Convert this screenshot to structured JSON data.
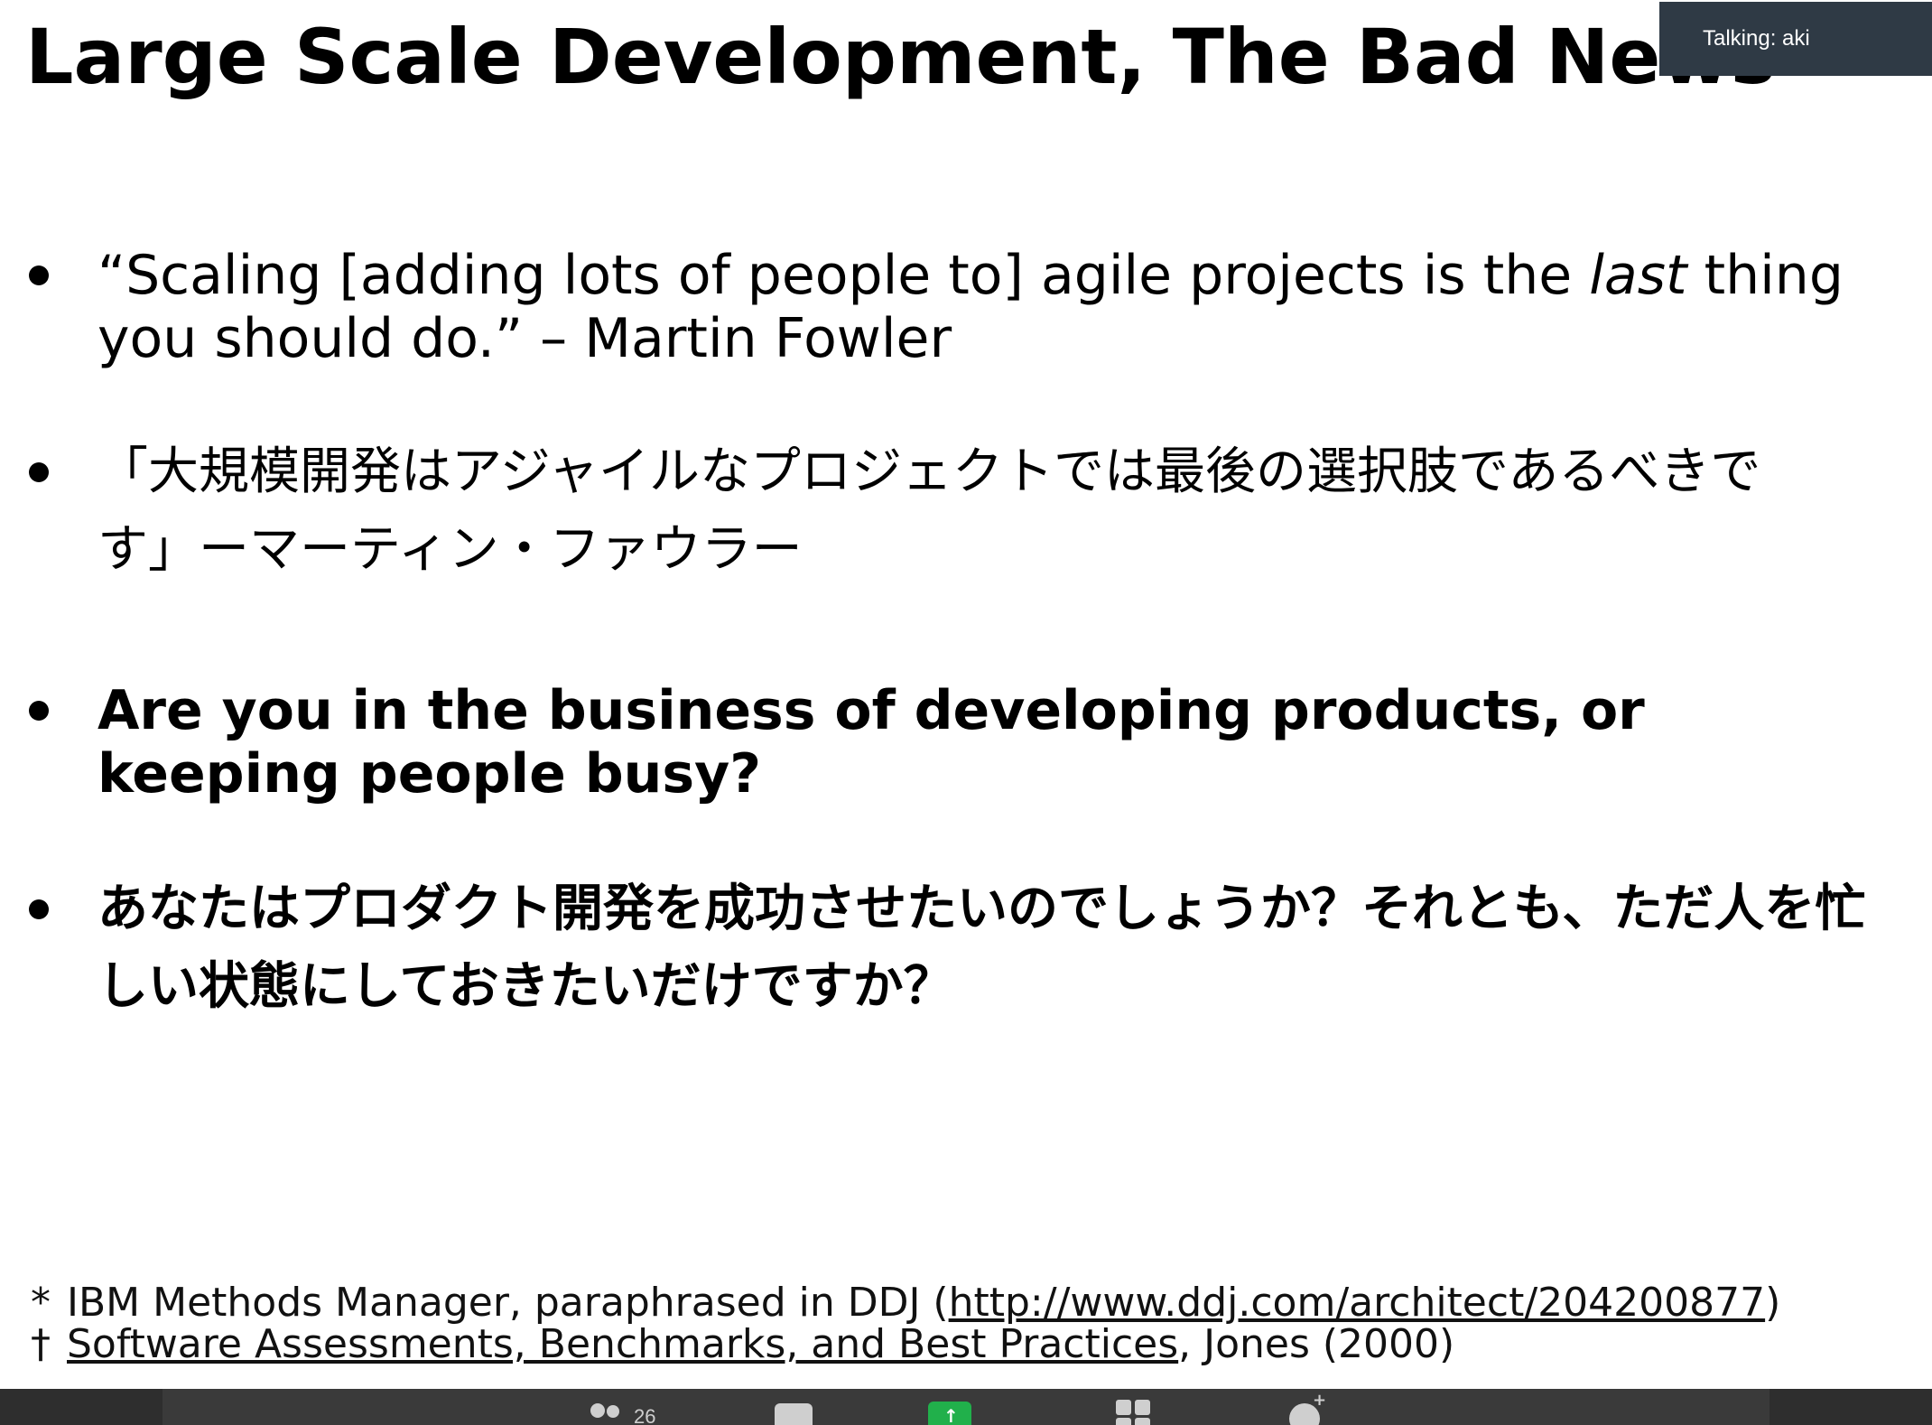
{
  "slide": {
    "title": "Large Scale Development, The Bad News",
    "bullets": [
      {
        "text_before": "“Scaling [adding lots of people to] agile projects is the ",
        "emphasis": "last",
        "text_after": " thing you should do.” – Martin Fowler"
      },
      {
        "text": "「大規模開発はアジャイルなプロジェクトでは最後の選択肢であるべきです」ーマーティン・ファウラー"
      },
      {
        "text": "Are you in the business of developing products, or keeping people busy?"
      },
      {
        "text": "あなたはプロダクト開発を成功させたいのでしょうか？それとも、ただ人を忙しい状態にしておきたいだけですか？"
      }
    ],
    "footnotes": [
      {
        "mark": "*",
        "text_before": "IBM Methods Manager, paraphrased in DDJ (",
        "link": "http://www.ddj.com/architect/204200877",
        "text_after": ")"
      },
      {
        "mark": "†",
        "link": "Software Assessments, Benchmarks, and Best Practices",
        "text_after": ", Jones (2000)"
      }
    ]
  },
  "overlay": {
    "talking_label": "Talking: aki"
  },
  "toolbar": {
    "participants_count": "26",
    "icons": {
      "participants": "participants-icon",
      "chat": "chat-icon",
      "share": "share-screen-icon",
      "apps": "apps-icon",
      "reactions": "reactions-icon"
    },
    "share_color": "#21b04b"
  }
}
